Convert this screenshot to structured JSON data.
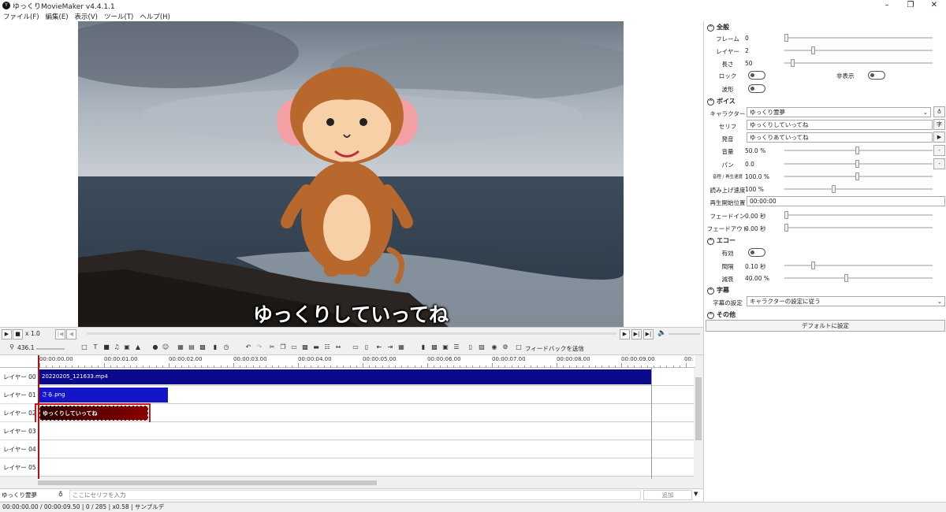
{
  "window": {
    "title": "ゆっくりMovieMaker v4.4.1.1",
    "icon_letter": "Y"
  },
  "menu": [
    "ファイル(F)",
    "編集(E)",
    "表示(V)",
    "ツール(T)",
    "ヘルプ(H)"
  ],
  "preview": {
    "subtitle": "ゆっくりしていってね"
  },
  "playbar": {
    "speed": "x 1.0"
  },
  "toolbar": {
    "zoom": "436.1",
    "feedback_label": "フィードバックを送信"
  },
  "timeline": {
    "ruler_labels": [
      "00:00:00.00",
      "00:00:01.00",
      "00:00:02.00",
      "00:00:03.00",
      "00:00:04.00",
      "00:00:05.00",
      "00:00:06.00",
      "00:00:07.00",
      "00:00:08.00",
      "00:00:09.00",
      "00:"
    ],
    "layers": [
      {
        "label": "レイヤー 00",
        "clip": "20220205_121633.mp4"
      },
      {
        "label": "レイヤー 01",
        "clip": "さる.png"
      },
      {
        "label": "レイヤー 02",
        "clip": "ゆっくりしていってね"
      },
      {
        "label": "レイヤー 03",
        "clip": ""
      },
      {
        "label": "レイヤー 04",
        "clip": ""
      },
      {
        "label": "レイヤー 05",
        "clip": ""
      }
    ]
  },
  "inputbar": {
    "character": "ゆっくり霊夢",
    "placeholder": "ここにセリフを入力",
    "add_label": "追加"
  },
  "status": "00:00:00.00 / 00:00:09.50 | 0 / 285 | x0.58 | サンプルデ",
  "panel": {
    "general": {
      "title": "全般",
      "frame_label": "フレーム",
      "frame_value": "0",
      "layer_label": "レイヤー",
      "layer_value": "2",
      "length_label": "長さ",
      "length_value": "50",
      "lock_label": "ロック",
      "hidden_label": "非表示",
      "wave_label": "波形"
    },
    "voice": {
      "title": "ボイス",
      "character_label": "キャラクター",
      "character_value": "ゆっくり霊夢",
      "serif_label": "セリフ",
      "serif_value": "ゆっくりしていってね",
      "pron_label": "発音",
      "pron_value": "ゆっくりあていってね",
      "volume_label": "音量",
      "volume_value": "50.0 %",
      "pan_label": "パン",
      "pan_value": "0.0",
      "pitch_label": "音程 / 再生速度",
      "pitch_value": "100.0 %",
      "readspeed_label": "読み上げ速度",
      "readspeed_value": "100 %",
      "start_label": "再生開始位置",
      "start_value": "00:00:00",
      "fadein_label": "フェードイン",
      "fadein_value": "0.00 秒",
      "fadeout_label": "フェードアウト",
      "fadeout_value": "0.00 秒"
    },
    "echo": {
      "title": "エコー",
      "enable_label": "有効",
      "interval_label": "間隔",
      "interval_value": "0.10 秒",
      "decay_label": "減衰",
      "decay_value": "40.00 %"
    },
    "subtitle": {
      "title": "字幕",
      "setting_label": "字幕の設定",
      "setting_value": "キャラクターの設定に従う"
    },
    "other": {
      "title": "その他"
    },
    "default_button": "デフォルトに設定"
  }
}
